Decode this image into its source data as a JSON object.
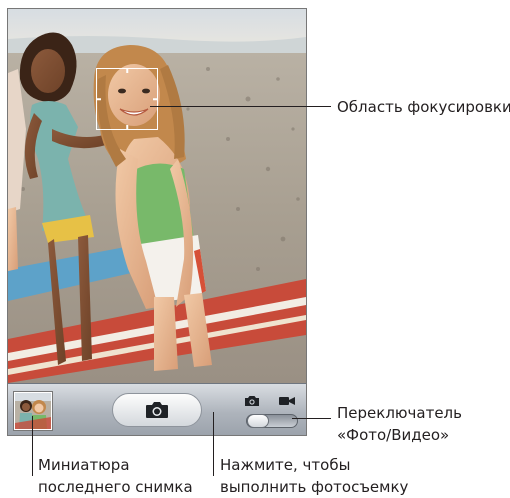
{
  "annotations": {
    "focus_area": "Область фокусировки",
    "mode_switch": {
      "line1": "Переключатель",
      "line2": "«Фото/Видео»"
    },
    "last_photo_thumbnail": {
      "line1": "Миниатюра",
      "line2": "последнего снимка"
    },
    "shutter": {
      "line1": "Нажмите, чтобы",
      "line2": "выполнить фотосъемку"
    }
  },
  "icons": {
    "shutter": "camera-icon",
    "mode_photo": "camera-icon",
    "mode_video": "video-camera-icon"
  },
  "mode_switch_state": "photo",
  "colors": {
    "toolbar": "#aeb4bc",
    "callout": "#231f20"
  }
}
